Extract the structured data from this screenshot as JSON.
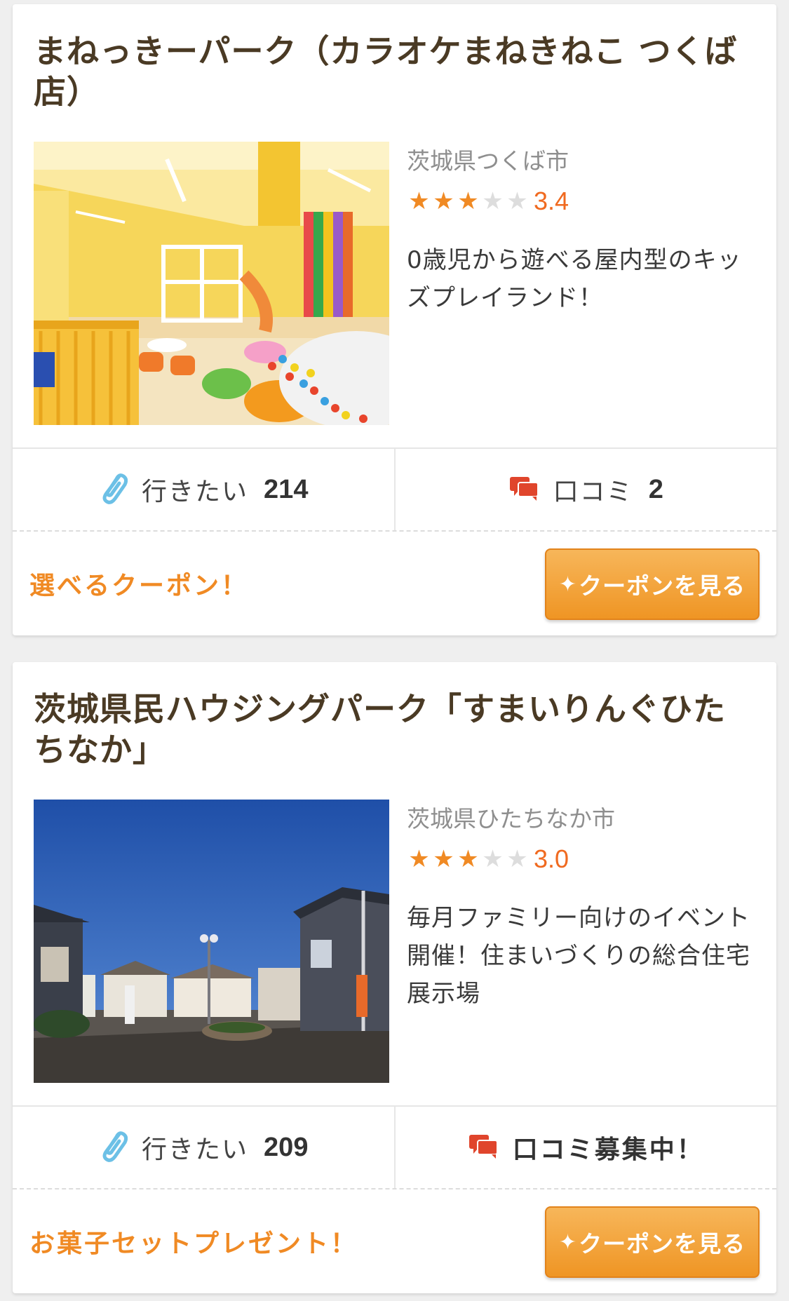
{
  "listings": [
    {
      "title": "まねっきーパーク（カラオケまねきねこ つくば店）",
      "location": "茨城県つくば市",
      "rating": 3.4,
      "rating_label": "3.4",
      "stars_filled": 3,
      "description": "0歳児から遊べる屋内型のキッズプレイランド！",
      "want_label": "行きたい",
      "want_count": "214",
      "review_label": "口コミ",
      "review_count": "2",
      "promo": "選べるクーポン！",
      "coupon_button": "クーポンを見る",
      "photo_scene": "indoor-kids-playground"
    },
    {
      "title": "茨城県民ハウジングパーク「すまいりんぐひたちなか」",
      "location": "茨城県ひたちなか市",
      "rating": 3.0,
      "rating_label": "3.0",
      "stars_filled": 3,
      "description": "毎月ファミリー向けのイベント開催！住まいづくりの総合住宅展示場",
      "want_label": "行きたい",
      "want_count": "209",
      "review_label": "口コミ募集中！",
      "review_count": "",
      "promo": "お菓子セットプレゼント！",
      "coupon_button": "クーポンを見る",
      "photo_scene": "housing-exhibition-street"
    }
  ],
  "icons": {
    "want": "paperclip-icon",
    "review": "speech-bubbles-icon",
    "coupon": "sparkle-icon"
  },
  "colors": {
    "accent_orange": "#f08a24",
    "rating_orange": "#f06a20",
    "title_brown": "#4a3a24",
    "review_icon_red": "#e0452c",
    "paperclip_blue": "#6cc0e6"
  }
}
